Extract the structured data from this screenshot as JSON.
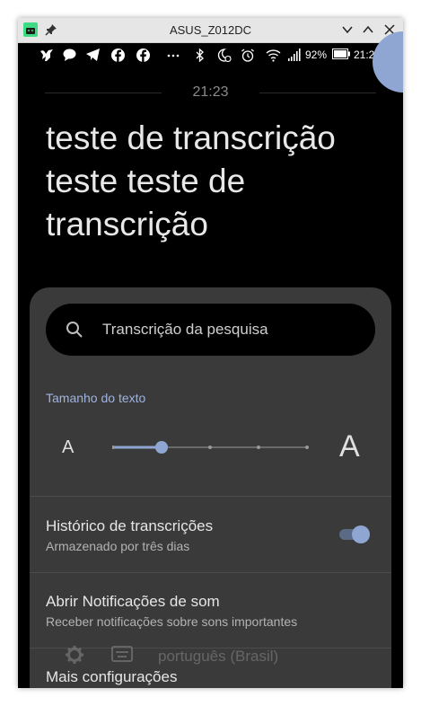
{
  "window": {
    "title": "ASUS_Z012DC"
  },
  "status_bar": {
    "battery": "92%",
    "time": "21:23",
    "notification_icons": [
      "bird-icon",
      "chat-icon",
      "telegram-icon",
      "facebook-icon",
      "facebook-icon",
      "more-dots-icon"
    ],
    "system_icons": [
      "bluetooth-icon",
      "do-not-disturb-icon",
      "alarm-icon",
      "wifi-icon",
      "signal-icon",
      "battery-icon"
    ]
  },
  "screen": {
    "time": "21:23",
    "transcript_lines": [
      "teste de transcrição",
      "teste teste de",
      "transcrição"
    ]
  },
  "panel": {
    "search_placeholder": "Transcrição da pesquisa",
    "text_size": {
      "label": "Tamanho do texto",
      "small_glyph": "A",
      "large_glyph": "A",
      "steps": 5,
      "selected_step": 2
    },
    "history": {
      "title": "Histórico de transcrições",
      "subtitle": "Armazenado por três dias",
      "enabled": true
    },
    "sound_notifications": {
      "title": "Abrir Notificações de som",
      "subtitle": "Receber notificações sobre sons importantes"
    },
    "more_settings": {
      "title": "Mais configurações"
    }
  },
  "bottom_bar": {
    "language": "português (Brasil)"
  },
  "colors": {
    "accent": "#8fa6d2",
    "panel_bg": "#3a3a3a",
    "background": "#000000"
  }
}
